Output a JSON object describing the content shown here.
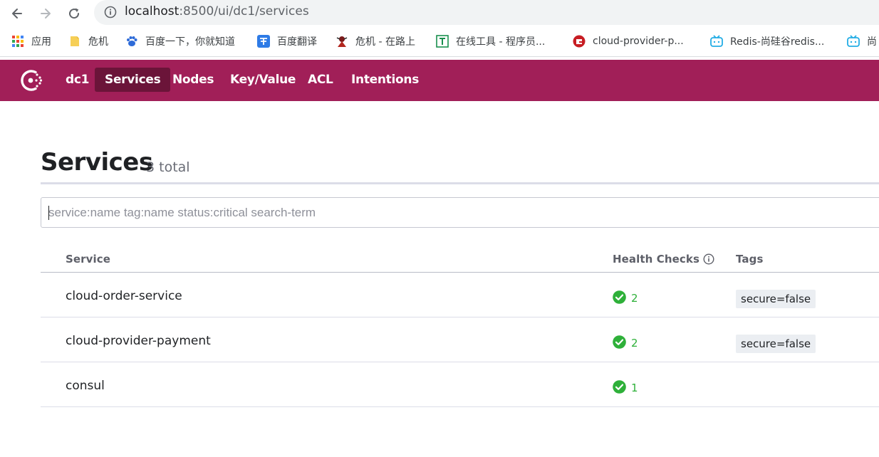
{
  "browser": {
    "url_host": "localhost",
    "url_path": ":8500/ui/dc1/services",
    "bookmarks": [
      {
        "label": "应用",
        "icon": "apps-grid-icon"
      },
      {
        "label": "危机",
        "icon": "folder-icon"
      },
      {
        "label": "百度一下，你就知道",
        "icon": "baidu-paw-icon"
      },
      {
        "label": "百度翻译",
        "icon": "translate-icon"
      },
      {
        "label": "危机 - 在路上",
        "icon": "ninja-avatar-icon"
      },
      {
        "label": "在线工具 - 程序员...",
        "icon": "tool-t-icon"
      },
      {
        "label": "cloud-provider-p...",
        "icon": "gitee-icon"
      },
      {
        "label": "Redis-尚硅谷redis...",
        "icon": "bilibili-icon"
      },
      {
        "label": "尚",
        "icon": "bilibili-icon"
      }
    ]
  },
  "header": {
    "datacenter": "dc1",
    "nav": [
      {
        "label": "Services",
        "active": true
      },
      {
        "label": "Nodes",
        "active": false
      },
      {
        "label": "Key/Value",
        "active": false
      },
      {
        "label": "ACL",
        "active": false
      },
      {
        "label": "Intentions",
        "active": false
      }
    ],
    "brand_color": "#a11f58",
    "active_color": "#6b1439"
  },
  "main": {
    "title": "Services",
    "count_label": "3 total",
    "search": {
      "value": "",
      "placeholder": "service:name tag:name status:critical search-term"
    },
    "columns": {
      "service": "Service",
      "health": "Health Checks",
      "tags": "Tags"
    },
    "services": [
      {
        "name": "cloud-order-service",
        "passing": "2",
        "tag": "secure=false"
      },
      {
        "name": "cloud-provider-payment",
        "passing": "2",
        "tag": "secure=false"
      },
      {
        "name": "consul",
        "passing": "1",
        "tag": ""
      }
    ],
    "status_color": "#2eb039"
  }
}
